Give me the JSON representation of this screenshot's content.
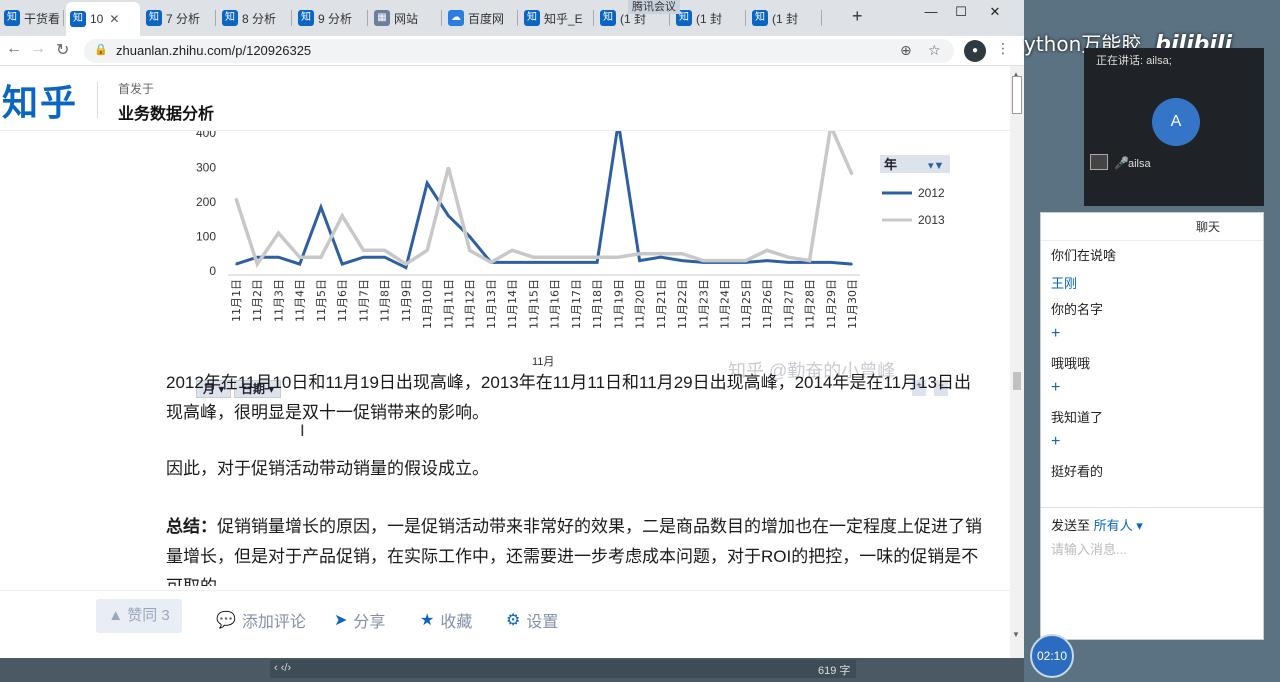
{
  "browser": {
    "tabs": [
      {
        "label": "干货看",
        "icon": "知"
      },
      {
        "label": "10",
        "icon": "知"
      },
      {
        "label": "7 分析",
        "icon": "知"
      },
      {
        "label": "8 分析",
        "icon": "知"
      },
      {
        "label": "9 分析",
        "icon": "知"
      },
      {
        "label": "网站",
        "icon": "▦"
      },
      {
        "label": "百度网",
        "icon": "☁"
      },
      {
        "label": "知乎_E",
        "icon": "知"
      },
      {
        "label": "(1 封",
        "icon": "知"
      },
      {
        "label": "(1 封",
        "icon": "知"
      },
      {
        "label": "(1 封",
        "icon": "知"
      }
    ],
    "meeting_banner": "腾讯会议",
    "new_tab": "+",
    "url": "zhuanlan.zhihu.com/p/120926325",
    "window_min": "—",
    "window_max": "☐",
    "window_close": "✕"
  },
  "header": {
    "logo": "知乎",
    "published_in": "首发于",
    "column_title": "业务数据分析"
  },
  "chart_data": {
    "type": "line",
    "x_label": "11月",
    "categories": [
      "11月1日",
      "11月2日",
      "11月3日",
      "11月4日",
      "11月5日",
      "11月6日",
      "11月7日",
      "11月8日",
      "11月9日",
      "11月10日",
      "11月11日",
      "11月12日",
      "11月13日",
      "11月14日",
      "11月15日",
      "11月16日",
      "11月17日",
      "11月18日",
      "11月19日",
      "11月20日",
      "11月21日",
      "11月22日",
      "11月23日",
      "11月24日",
      "11月25日",
      "11月26日",
      "11月27日",
      "11月28日",
      "11月29日",
      "11月30日"
    ],
    "y_ticks": [
      "400",
      "300",
      "200",
      "100",
      "0"
    ],
    "ylim": [
      0,
      400
    ],
    "series": [
      {
        "name": "2012",
        "color": "#2e5fa3",
        "values": [
          20,
          40,
          40,
          20,
          185,
          20,
          40,
          40,
          10,
          255,
          160,
          100,
          25,
          25,
          25,
          25,
          25,
          25,
          430,
          30,
          40,
          30,
          25,
          25,
          25,
          30,
          25,
          25,
          25,
          20
        ]
      },
      {
        "name": "2013",
        "color": "#c8c8c8",
        "values": [
          210,
          20,
          110,
          40,
          40,
          160,
          60,
          60,
          20,
          60,
          300,
          60,
          25,
          60,
          40,
          40,
          40,
          40,
          40,
          50,
          50,
          50,
          30,
          30,
          30,
          60,
          40,
          30,
          420,
          280
        ]
      }
    ],
    "legend_title": "年",
    "filter_month": "月",
    "filter_date": "日期",
    "watermark": "知乎 @勤奋的小曾峰"
  },
  "article": {
    "p1": "2012年在11月10日和11月19日出现高峰，2013年在11月11日和11月29日出现高峰，2014年是在11月13日出现高峰，很明显是双十一促销带来的影响。",
    "p2": "因此，对于促销活动带动销量的假设成立。",
    "p3_bold": "总结：",
    "p3": "促销销量增长的原因，一是促销活动带来非常好的效果，二是商品数目的增加也在一定程度上促进了销量增长，但是对于产品促销，在实际工作中，还需要进一步考虑成本问题，对于ROI的把控，一味的促销是不可取的。"
  },
  "actions": {
    "vote": "赞同 3",
    "comment": "添加评论",
    "share": "分享",
    "collect": "收藏",
    "settings": "设置"
  },
  "statusbar": {
    "left": "‹ ‹/›",
    "right": "619 字"
  },
  "overlay": {
    "bilibili_text": "ython万能胶",
    "bilibili_logo": "bilibili",
    "speaking": "正在讲话: ailsa;",
    "avatar_letter": "A",
    "participant": "ailsa",
    "clock": "02:10"
  },
  "chat": {
    "title": "聊天",
    "messages": [
      {
        "sender": "",
        "text": "你们在说啥"
      },
      {
        "sender": "王刚",
        "text": "你的名字"
      },
      {
        "sender": "+",
        "text": "哦哦哦"
      },
      {
        "sender": "+",
        "text": "我知道了"
      },
      {
        "sender": "+",
        "text": "挺好看的"
      }
    ],
    "send_to_label": "发送至",
    "send_to_value": "所有人",
    "input_placeholder": "请输入消息..."
  }
}
